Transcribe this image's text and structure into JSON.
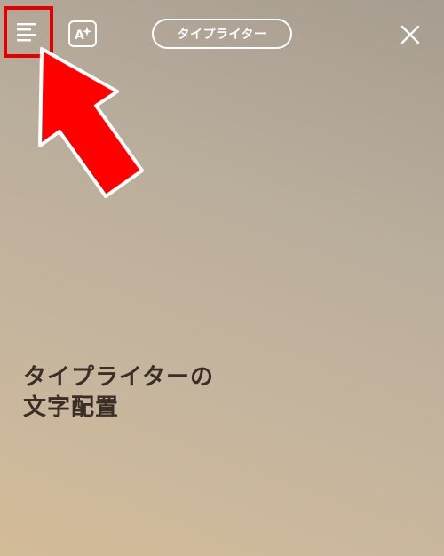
{
  "toolbar": {
    "align_icon": "align-left-icon",
    "effects_icon": "text-effects-icon",
    "effects_glyph": "A",
    "font_style_label": "タイプライター",
    "close_icon": "close-icon"
  },
  "annotation": {
    "highlight_color": "#e10000",
    "arrow_color": "#ff0000"
  },
  "caption": {
    "line1": "タイプライターの",
    "line2": "文字配置"
  }
}
